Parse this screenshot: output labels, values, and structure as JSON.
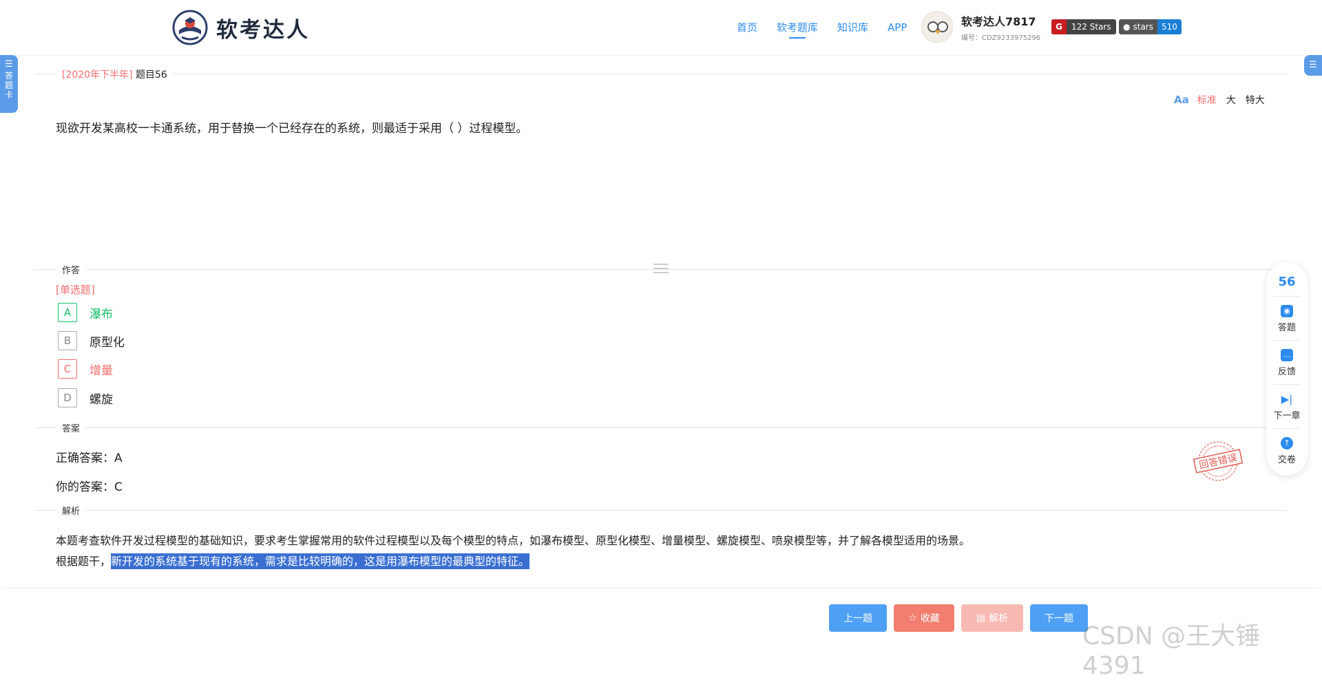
{
  "header": {
    "logo_text": "软考达人",
    "nav": [
      "首页",
      "软考题库",
      "知识库",
      "APP"
    ],
    "active_nav": "软考题库",
    "user_name": "软考达人7817",
    "user_id": "编号：CDZ9233975296",
    "gitee_badge": "122 Stars",
    "github_label": "stars",
    "github_count": "510"
  },
  "side": {
    "left_tab": "答题卡"
  },
  "question": {
    "year_tag": "[2020年下半年]",
    "number_label": "题目56",
    "font_options": [
      "标准",
      "大",
      "特大"
    ],
    "font_selected": "标准",
    "text": "现欲开发某高校一卡通系统，用于替换一个已经存在的系统，则最适于采用（ ）过程模型。"
  },
  "answer_section": {
    "label": "作答",
    "type": "[单选题]",
    "options": [
      {
        "letter": "A",
        "text": "瀑布",
        "state": "correct"
      },
      {
        "letter": "B",
        "text": "原型化",
        "state": "normal"
      },
      {
        "letter": "C",
        "text": "增量",
        "state": "wrong"
      },
      {
        "letter": "D",
        "text": "螺旋",
        "state": "normal"
      }
    ]
  },
  "result_section": {
    "label": "答案",
    "correct_answer": "正确答案：A",
    "your_answer": "你的答案：C",
    "stamp_text": "回答错误"
  },
  "analysis_section": {
    "label": "解析",
    "line1": "本题考查软件开发过程模型的基础知识，要求考生掌握常用的软件过程模型以及每个模型的特点，如瀑布模型、原型化模型、增量模型、螺旋模型、喷泉模型等，并了解各模型适用的场景。",
    "line2_prefix": "根据题干，",
    "line2_highlight": "新开发的系统基于现有的系统，需求是比较明确的，这是用瀑布模型的最典型的特征。"
  },
  "float_panel": {
    "number": "56",
    "items": [
      "答题",
      "反馈",
      "下一章",
      "交卷"
    ]
  },
  "bottom_bar": {
    "prev": "上一题",
    "fav": "收藏",
    "analysis": "解析",
    "next": "下一题"
  },
  "watermark": "CSDN @王大锤4391",
  "colors": {
    "primary": "#2d8cf0",
    "correct": "#19be6b",
    "wrong": "#f56c6c",
    "highlight": "#3a6fd1"
  }
}
